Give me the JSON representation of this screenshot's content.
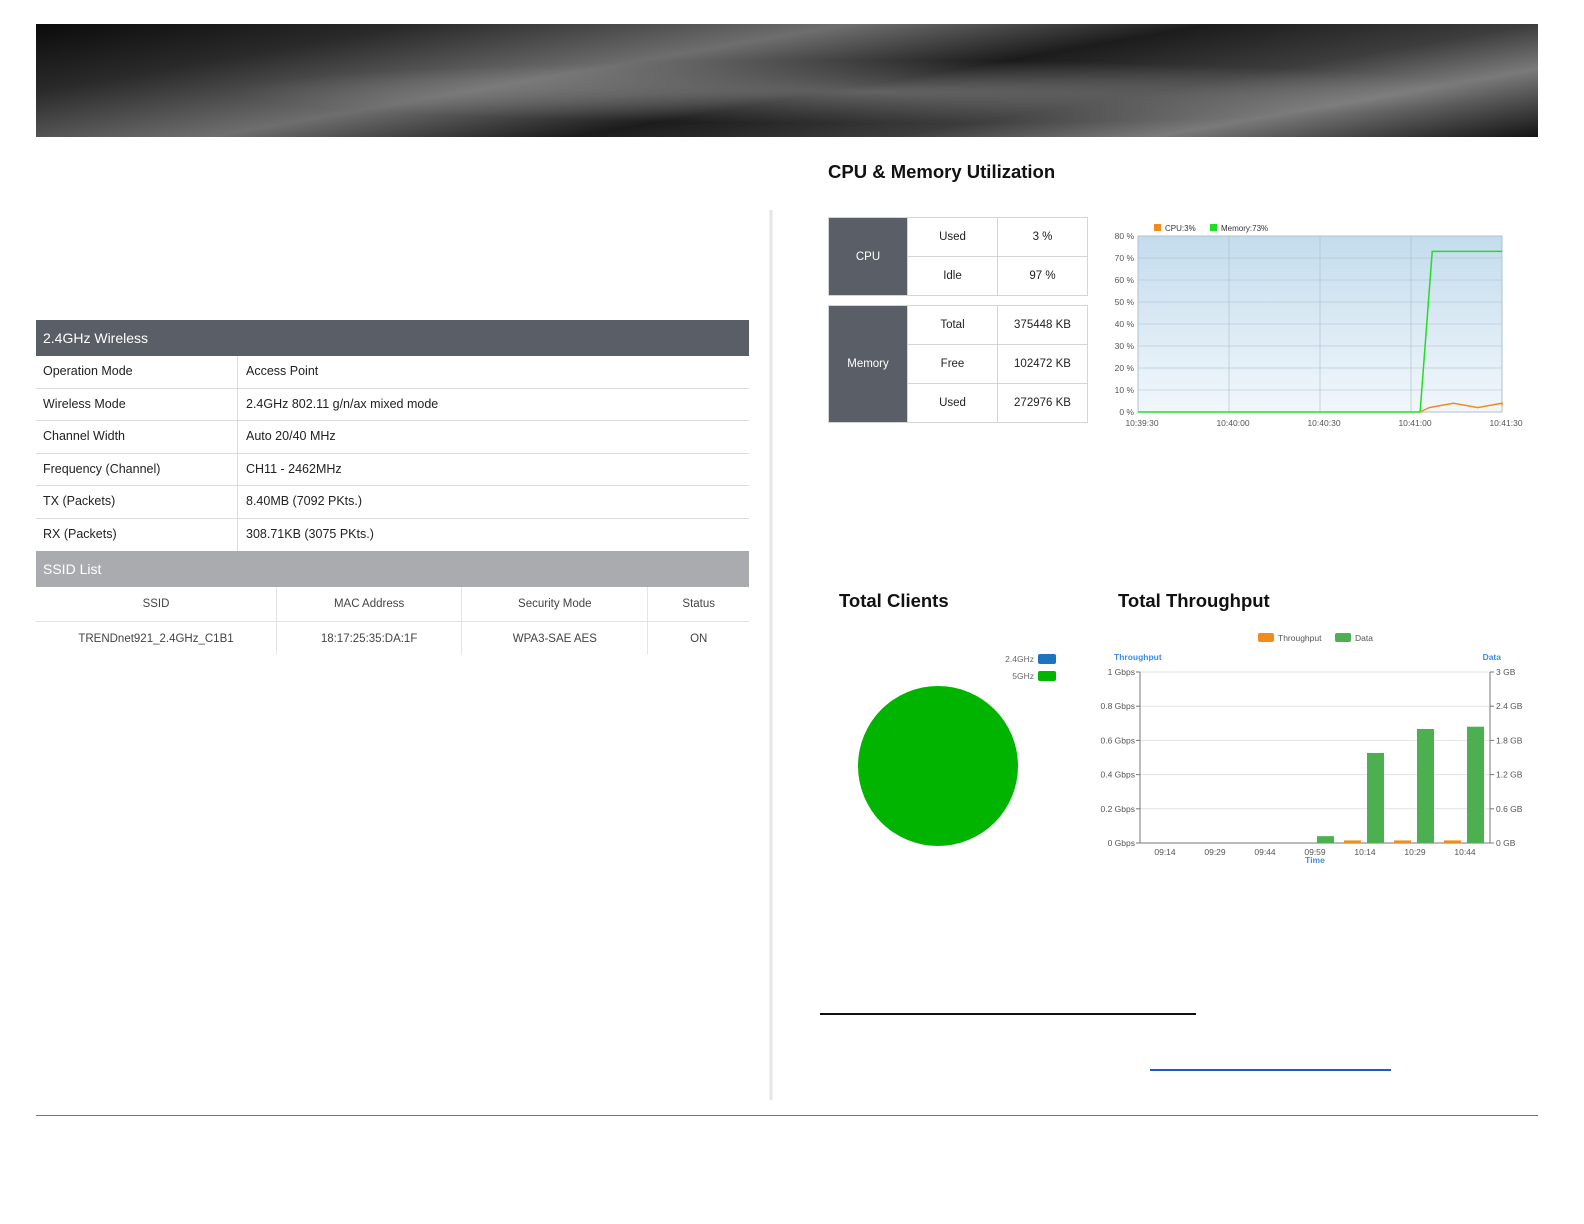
{
  "wireless": {
    "header": "2.4GHz Wireless",
    "rows": [
      {
        "label": "Operation Mode",
        "value": "Access Point"
      },
      {
        "label": "Wireless Mode",
        "value": "2.4GHz 802.11 g/n/ax mixed mode"
      },
      {
        "label": "Channel Width",
        "value": "Auto 20/40 MHz"
      },
      {
        "label": "Frequency (Channel)",
        "value": "CH11 - 2462MHz"
      },
      {
        "label": "TX (Packets)",
        "value": "8.40MB (7092 PKts.)"
      },
      {
        "label": "RX (Packets)",
        "value": "308.71KB (3075 PKts.)"
      }
    ]
  },
  "ssid_list": {
    "header": "SSID List",
    "columns": [
      "SSID",
      "MAC Address",
      "Security Mode",
      "Status"
    ],
    "rows": [
      {
        "ssid": "TRENDnet921_2.4GHz_C1B1",
        "mac": "18:17:25:35:DA:1F",
        "security": "WPA3-SAE AES",
        "status": "ON"
      }
    ]
  },
  "cpu_memory": {
    "title": "CPU & Memory Utilization",
    "cpu": {
      "label": "CPU",
      "used_label": "Used",
      "used_value": "3 %",
      "idle_label": "Idle",
      "idle_value": "97 %"
    },
    "memory": {
      "label": "Memory",
      "total_label": "Total",
      "total_value": "375448 KB",
      "free_label": "Free",
      "free_value": "102472 KB",
      "used_label": "Used",
      "used_value": "272976 KB"
    }
  },
  "total_clients": {
    "title": "Total Clients"
  },
  "total_throughput": {
    "title": "Total Throughput"
  },
  "chart_data": [
    {
      "type": "line",
      "legend": [
        "CPU:3%",
        "Memory:73%"
      ],
      "colors": {
        "cpu": "#f08c1e",
        "memory": "#22dd22"
      },
      "y_ticks": [
        "0 %",
        "10 %",
        "20 %",
        "30 %",
        "40 %",
        "50 %",
        "60 %",
        "70 %",
        "80 %"
      ],
      "x_ticks": [
        "10:39:30",
        "10:40:00",
        "10:40:30",
        "10:41:00",
        "10:41:30"
      ],
      "ylim": [
        0,
        80
      ],
      "xlim_seconds": [
        0,
        120
      ],
      "series": [
        {
          "name": "Memory:73%",
          "points": [
            [
              0,
              0
            ],
            [
              93,
              0
            ],
            [
              97,
              73
            ],
            [
              127,
              73
            ]
          ]
        },
        {
          "name": "CPU:3%",
          "points": [
            [
              93,
              0
            ],
            [
              96,
              2
            ],
            [
              100,
              3
            ],
            [
              104,
              4
            ],
            [
              108,
              3
            ],
            [
              112,
              2
            ],
            [
              116,
              3
            ],
            [
              120,
              4
            ],
            [
              124,
              3
            ],
            [
              127,
              4
            ]
          ]
        }
      ],
      "grid": true
    },
    {
      "type": "pie",
      "legend": [
        "2.4GHz",
        "5GHz"
      ],
      "colors": [
        "#1e73be",
        "#00b400"
      ],
      "values": [
        0,
        1
      ]
    },
    {
      "type": "bar",
      "legend": [
        "Throughput",
        "Data"
      ],
      "colors": {
        "throughput": "#f08c1e",
        "data": "#4caf50"
      },
      "left_axis_title": "Throughput",
      "right_axis_title": "Data",
      "x_axis_title": "Time",
      "categories": [
        "09:14",
        "09:29",
        "09:44",
        "09:59",
        "10:14",
        "10:29",
        "10:44"
      ],
      "left_ticks": [
        "0 Gbps",
        "0.2 Gbps",
        "0.4 Gbps",
        "0.6 Gbps",
        "0.8 Gbps",
        "1 Gbps"
      ],
      "right_ticks": [
        "0 GB",
        "0.6 GB",
        "1.2 GB",
        "1.8 GB",
        "2.4 GB",
        "3 GB"
      ],
      "ylim_left": [
        0,
        1
      ],
      "ylim_right": [
        0,
        3
      ],
      "series": [
        {
          "name": "Throughput",
          "axis": "left",
          "values": [
            0,
            0,
            0,
            0,
            0.015,
            0.015,
            0.015
          ]
        },
        {
          "name": "Data",
          "axis": "right",
          "values": [
            0,
            0,
            0,
            0.12,
            1.58,
            2.0,
            2.04
          ]
        }
      ]
    }
  ]
}
